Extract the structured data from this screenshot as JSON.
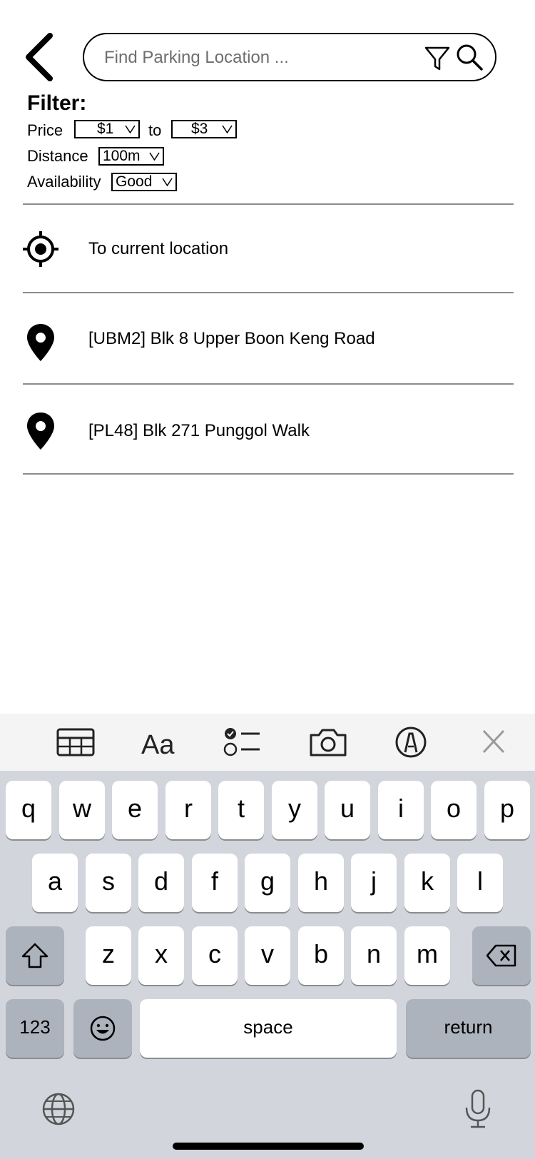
{
  "search": {
    "placeholder": "Find Parking Location ...",
    "value": ""
  },
  "filter": {
    "title": "Filter:",
    "price_label": "Price",
    "price_from": "$1",
    "price_to_word": "to",
    "price_to": "$3",
    "distance_label": "Distance",
    "distance_value": "100m",
    "availability_label": "Availability",
    "availability_value": "Good"
  },
  "results": [
    {
      "icon": "crosshair-icon",
      "label": "To current location"
    },
    {
      "icon": "map-pin-icon",
      "label": "[UBM2] Blk 8 Upper Boon Keng Road"
    },
    {
      "icon": "map-pin-icon",
      "label": "[PL48] Blk 271 Punggol Walk"
    }
  ],
  "keyboard": {
    "toolbar_icons": [
      "table-icon",
      "text-format-icon",
      "checklist-icon",
      "camera-icon",
      "markup-icon",
      "close-icon"
    ],
    "row1": [
      "q",
      "w",
      "e",
      "r",
      "t",
      "y",
      "u",
      "i",
      "o",
      "p"
    ],
    "row2": [
      "a",
      "s",
      "d",
      "f",
      "g",
      "h",
      "j",
      "k",
      "l"
    ],
    "row3": [
      "z",
      "x",
      "c",
      "v",
      "b",
      "n",
      "m"
    ],
    "numbers_label": "123",
    "space_label": "space",
    "return_label": "return"
  },
  "colors": {
    "keyboard_bg": "#d2d5db",
    "toolbar_bg": "#f4f4f5",
    "dark_key": "#adb3bd",
    "divider": "#8c8c8c"
  }
}
